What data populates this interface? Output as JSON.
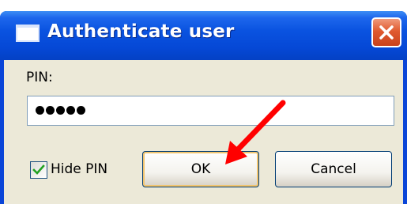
{
  "dialog": {
    "title": "Authenticate user",
    "app_icon": "window-icon",
    "close_icon": "close-icon",
    "accent_color": "#0a45d8",
    "close_color": "#e05a2f"
  },
  "form": {
    "pin_label": "PIN:",
    "pin_value_masked": "•••••",
    "pin_length": 5,
    "hide_pin_label": "Hide PIN",
    "hide_pin_checked": true
  },
  "buttons": {
    "ok_label": "OK",
    "cancel_label": "Cancel"
  },
  "annotation": {
    "type": "arrow-pointer",
    "color": "#ff0000",
    "target": "ok-button"
  }
}
